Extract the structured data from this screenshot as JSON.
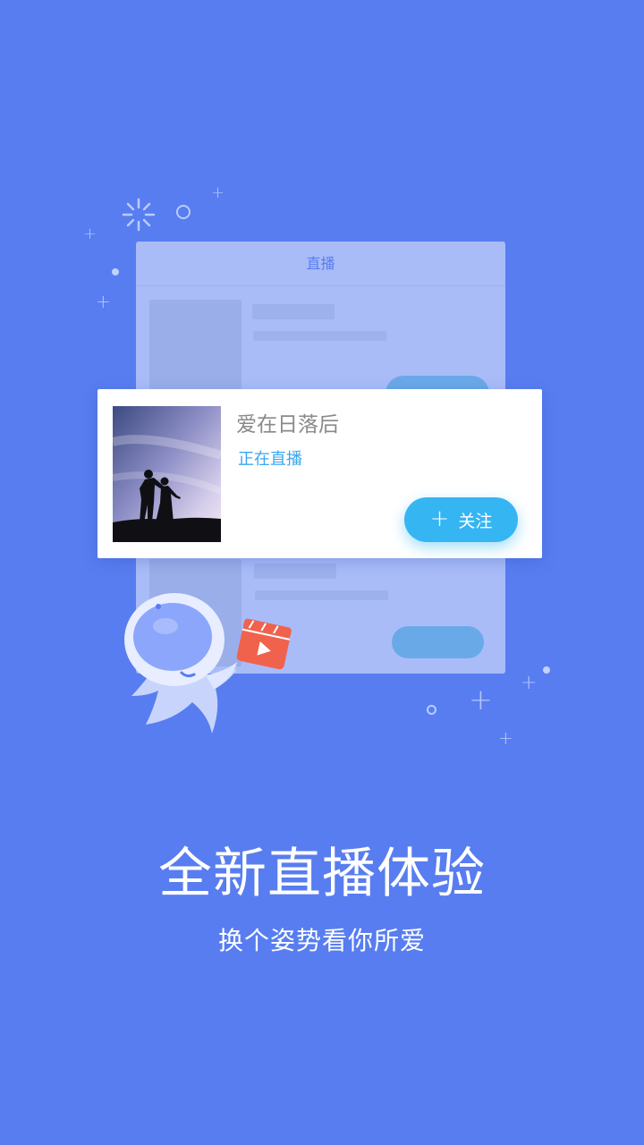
{
  "colors": {
    "background": "#587df0",
    "mock_window": "#a9bcf8",
    "card": "#ffffff",
    "accent_blue": "#36b5f3",
    "status_text": "#3aa7ee",
    "video_icon": "#f0624c"
  },
  "mock_window": {
    "title": "直播"
  },
  "card": {
    "title": "爱在日落后",
    "status": "正在直播",
    "follow_button": {
      "icon": "plus-icon",
      "label": "关注"
    },
    "thumbnail": "sunset-couple-silhouette"
  },
  "mascot": {
    "icon": "astronaut-mascot-icon",
    "prop_icon": "video-clapper-icon"
  },
  "headline": "全新直播体验",
  "subline": "换个姿势看你所爱"
}
